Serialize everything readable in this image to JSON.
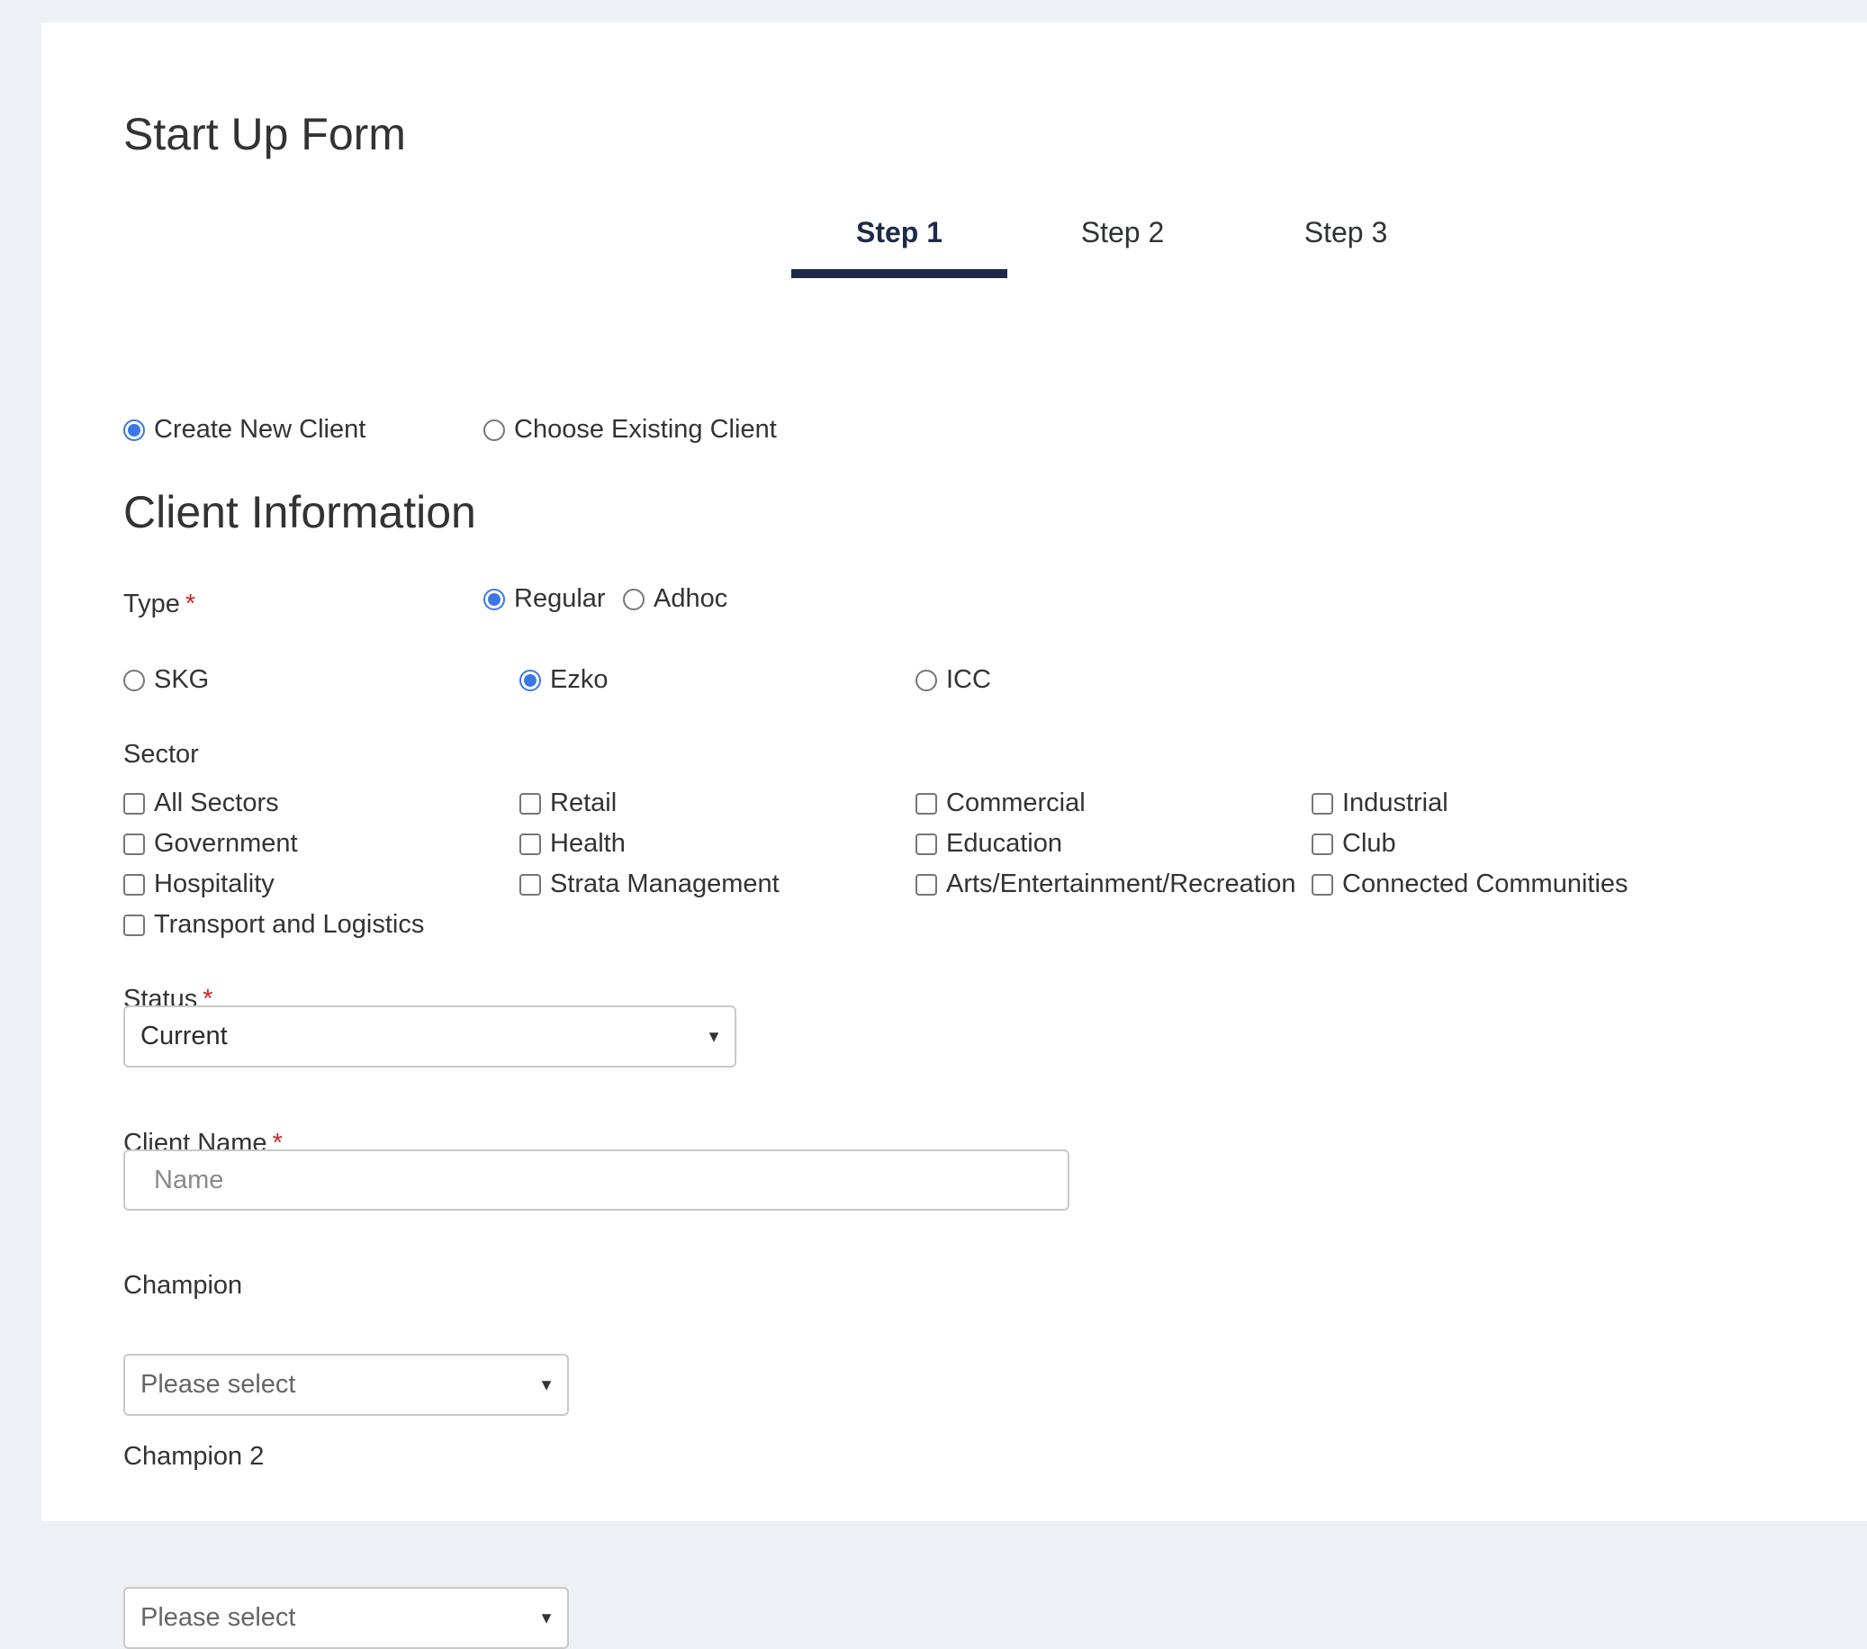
{
  "form": {
    "title": "Start Up Form"
  },
  "steps": [
    {
      "label": "Step 1",
      "active": true
    },
    {
      "label": "Step 2",
      "active": false
    },
    {
      "label": "Step 3",
      "active": false
    }
  ],
  "client_mode": {
    "options": [
      {
        "label": "Create New Client",
        "checked": true
      },
      {
        "label": "Choose Existing Client",
        "checked": false
      }
    ]
  },
  "client_info": {
    "title": "Client Information",
    "type": {
      "label": "Type",
      "required_mark": "*",
      "options": [
        {
          "label": "Regular",
          "checked": true
        },
        {
          "label": "Adhoc",
          "checked": false
        }
      ]
    },
    "company": {
      "options": [
        {
          "label": "SKG",
          "checked": false
        },
        {
          "label": "Ezko",
          "checked": true
        },
        {
          "label": "ICC",
          "checked": false
        }
      ]
    },
    "sector": {
      "label": "Sector",
      "options": [
        "All Sectors",
        "Retail",
        "Commercial",
        "Industrial",
        "Government",
        "Health",
        "Education",
        "Club",
        "Hospitality",
        "Strata Management",
        "Arts/Entertainment/Recreation",
        "Connected Communities",
        "Transport and Logistics"
      ]
    },
    "status": {
      "label": "Status",
      "required_mark": "*",
      "value": "Current",
      "caret": "▼"
    },
    "client_name": {
      "label": "Client Name",
      "required_mark": "*",
      "placeholder": "Name"
    },
    "champion": {
      "label": "Champion",
      "value": "Please select",
      "caret": "▼"
    },
    "champion2": {
      "label": "Champion 2",
      "value": "Please select",
      "caret": "▼"
    }
  }
}
